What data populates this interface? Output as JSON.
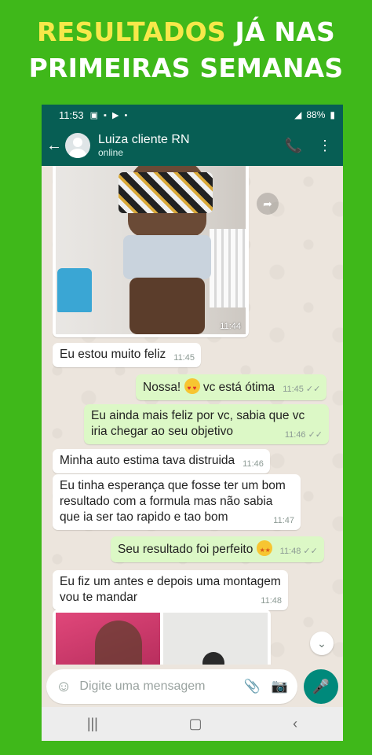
{
  "headline": {
    "part1": "RESULTADOS",
    "part2": " JÁ NAS",
    "line2": "PRIMEIRAS SEMANAS"
  },
  "statusbar": {
    "time": "11:53",
    "battery": "88%"
  },
  "appbar": {
    "contact_name": "Luiza cliente RN",
    "contact_status": "online"
  },
  "chat": {
    "photo_time": "11:44",
    "messages": [
      {
        "dir": "in",
        "text": "Eu estou muito feliz",
        "time": "11:45"
      },
      {
        "dir": "out",
        "text_before": "Nossa! ",
        "emoji": "heart-eyes-emoji",
        "text_after": " vc está ótima",
        "time": "11:45"
      },
      {
        "dir": "out",
        "text": "Eu ainda mais feliz por vc, sabia que vc iria chegar ao seu objetivo",
        "time": "11:46"
      },
      {
        "dir": "in",
        "text": "Minha auto estima tava distruida",
        "time": "11:46"
      },
      {
        "dir": "in",
        "text": "Eu tinha esperança que fosse ter um bom resultado com a formula mas não sabia que ia ser tao rapido e tao bom",
        "time": "11:47"
      },
      {
        "dir": "out",
        "text": "Seu resultado foi perfeito ",
        "emoji": "star-struck-emoji",
        "time": "11:48"
      },
      {
        "dir": "in",
        "text": "Eu fiz um antes e depois uma montagem vou te mandar",
        "time": "11:48"
      }
    ]
  },
  "composer": {
    "placeholder": "Digite uma mensagem"
  },
  "colors": {
    "background": "#3fb81a",
    "headline_accent": "#f7e84a",
    "header": "#075e54",
    "outgoing_bubble": "#dcf8c6",
    "mic_button": "#00897b"
  },
  "icons": [
    "back-arrow-icon",
    "add-call-icon",
    "more-vert-icon",
    "forward-icon",
    "scroll-down-icon",
    "emoji-icon",
    "attach-icon",
    "camera-icon",
    "mic-icon"
  ]
}
